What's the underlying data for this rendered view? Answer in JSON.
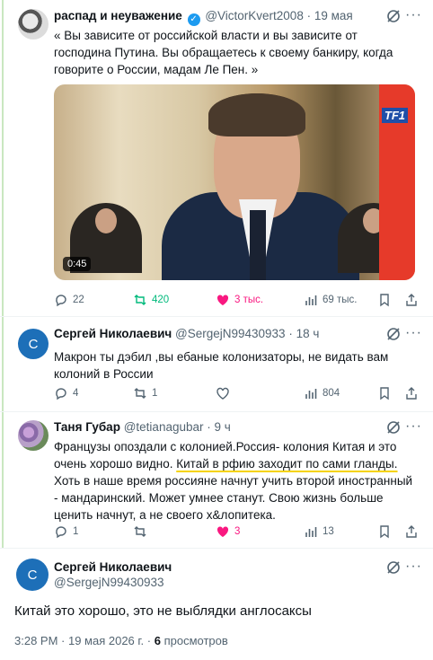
{
  "tweet1": {
    "name": "распад и неуважение",
    "handle": "@VictorKvert2008",
    "date": "19 мая",
    "text": "« Вы зависите от российской власти и вы зависите от господина Путина. Вы обращаетесь к своему банкиру, когда говорите о России, мадам Ле Пен. »",
    "video_duration": "0:45",
    "video_logo": "TF1",
    "replies": "22",
    "retweets": "420",
    "likes": "3 тыс.",
    "views": "69 тыс."
  },
  "tweet2": {
    "avatar_letter": "C",
    "name": "Сергей Николаевич",
    "handle": "@SergejN99430933",
    "date": "18 ч",
    "text": "Макрон ты дэбил ,вы ебаные колонизаторы, не видать вам колоний в России",
    "replies": "4",
    "retweets": "1",
    "likes": "",
    "views": "804"
  },
  "tweet3": {
    "name": "Таня Губар",
    "handle": "@tetianagubar",
    "date": "9 ч",
    "text_before": "Французы опоздали с колонией.Россия- колония Китая и это очень хорошо видно. ",
    "text_highlight": "Китай в рфию заходит по сами гланды.",
    "text_after": " Хоть в наше время россияне начнут учить второй иностранный - мандаринский. Может умнее станут. Свою жизнь больше ценить начнут, а не своего х&лопитека.",
    "replies": "1",
    "retweets": "",
    "likes": "3",
    "views": "13"
  },
  "main": {
    "avatar_letter": "C",
    "name": "Сергей Николаевич",
    "handle": "@SergejN99430933",
    "text": "Китай это хорошо, это не выблядки англосаксы",
    "time": "3:28 PM · 19 мая 2026 г. · ",
    "views_count": "6",
    "views_label": " просмотров"
  },
  "icons": [
    "verified-badge-icon",
    "grok-icon",
    "more-icon",
    "reply-icon",
    "retweet-icon",
    "like-icon",
    "views-icon",
    "bookmark-icon",
    "share-icon"
  ],
  "colors": {
    "accent": "#1d9bf0",
    "retweet": "#00ba7c",
    "like": "#f91880",
    "muted": "#536471",
    "highlight": "#f5d300"
  }
}
